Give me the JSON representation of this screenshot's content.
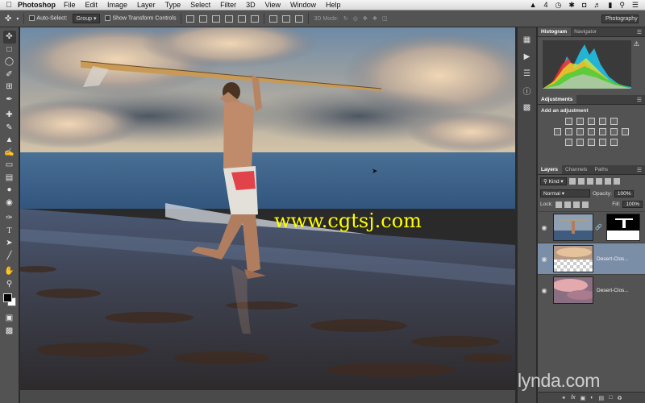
{
  "menubar": {
    "app": "Photoshop",
    "items": [
      "File",
      "Edit",
      "Image",
      "Layer",
      "Type",
      "Select",
      "Filter",
      "3D",
      "View",
      "Window",
      "Help"
    ],
    "status_text": "4"
  },
  "options_bar": {
    "auto_select_label": "Auto-Select:",
    "auto_select_value": "Group",
    "transform_label": "Show Transform Controls",
    "mode_3d_label": "3D Mode:",
    "workspace": "Photography"
  },
  "panels": {
    "histogram_tabs": [
      "Histogram",
      "Navigator"
    ],
    "adjustments_tab": "Adjustments",
    "adjustments_title": "Add an adjustment",
    "layers_tabs": [
      "Layers",
      "Channels",
      "Paths"
    ],
    "kind_filter": "Kind",
    "blend_mode": "Normal",
    "opacity_label": "Opacity:",
    "opacity_value": "100%",
    "lock_label": "Lock:",
    "fill_label": "Fill:",
    "fill_value": "100%"
  },
  "layers": [
    {
      "name": "",
      "has_mask": true,
      "selected": false,
      "visible": true
    },
    {
      "name": "Desert-Clos...",
      "has_mask": false,
      "selected": true,
      "visible": true
    },
    {
      "name": "Desert-Clos...",
      "has_mask": false,
      "selected": false,
      "visible": true
    }
  ],
  "watermarks": {
    "site": "www.cgtsj.com",
    "brand": "lynda",
    "brand_suffix": ".com"
  },
  "colors": {
    "watermark": "#ffff00",
    "selected_layer": "#7b8ea8",
    "panel_bg": "#535353"
  }
}
